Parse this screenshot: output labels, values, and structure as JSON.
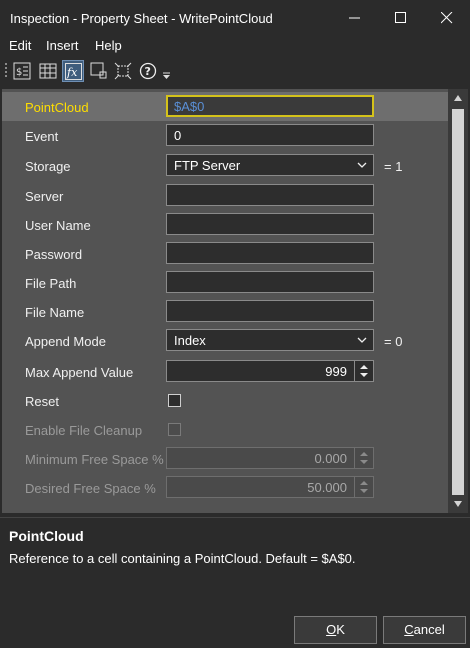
{
  "window": {
    "title": "Inspection - Property Sheet - WritePointCloud"
  },
  "menu": [
    "Edit",
    "Insert",
    "Help"
  ],
  "toolbar": [
    {
      "icon": "sort-properties-icon"
    },
    {
      "icon": "table-icon"
    },
    {
      "icon": "fx-icon",
      "active": true
    },
    {
      "icon": "region-select-icon"
    },
    {
      "icon": "fit-region-icon"
    },
    {
      "icon": "help-icon"
    },
    {
      "icon": "toolbar-options-icon"
    }
  ],
  "properties": [
    {
      "label": "PointCloud",
      "type": "text",
      "value": "$A$0",
      "selected": true
    },
    {
      "label": "Event",
      "type": "text",
      "value": "0"
    },
    {
      "label": "Storage",
      "type": "combo",
      "value": "FTP Server",
      "suffix": "= 1"
    },
    {
      "label": "Server",
      "type": "text",
      "value": ""
    },
    {
      "label": "User Name",
      "type": "text",
      "value": ""
    },
    {
      "label": "Password",
      "type": "text",
      "value": ""
    },
    {
      "label": "File Path",
      "type": "text",
      "value": ""
    },
    {
      "label": "File Name",
      "type": "text",
      "value": ""
    },
    {
      "label": "Append Mode",
      "type": "combo",
      "value": "Index",
      "suffix": "= 0"
    },
    {
      "label": "Max Append Value",
      "type": "numeric",
      "value": "999"
    },
    {
      "label": "Reset",
      "type": "checkbox"
    },
    {
      "label": "Enable File Cleanup",
      "type": "checkbox",
      "disabled": true
    },
    {
      "label": "Minimum Free Space %",
      "type": "numeric",
      "value": "0.000",
      "disabled": true
    },
    {
      "label": "Desired Free Space %",
      "type": "numeric",
      "value": "50.000",
      "disabled": true
    }
  ],
  "help": {
    "title": "PointCloud",
    "description": "Reference to a cell containing a PointCloud. Default = $A$0."
  },
  "buttons": {
    "ok": {
      "mnemonic": "O",
      "rest": "K"
    },
    "cancel": {
      "mnemonic": "C",
      "rest": "ancel"
    }
  },
  "colors": {
    "selected_label": "#ffde00",
    "focus_border": "#d4c21a",
    "active_tool": "#3f5d7d"
  }
}
